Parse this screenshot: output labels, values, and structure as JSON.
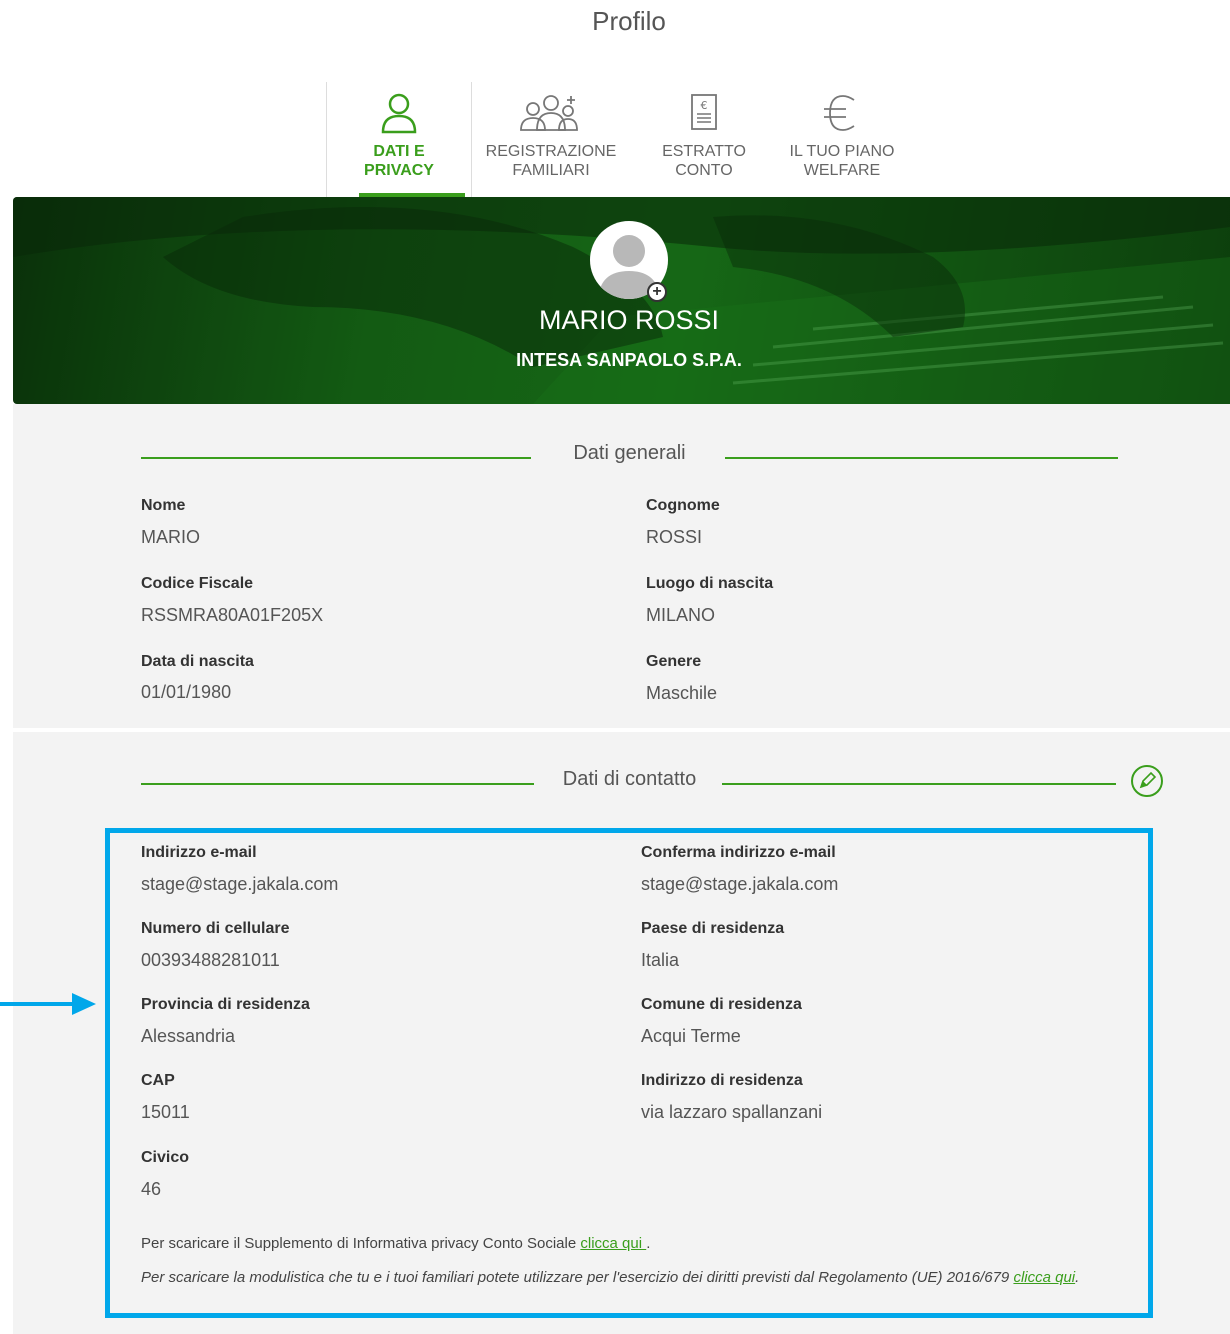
{
  "page": {
    "title": "Profilo"
  },
  "tabs": [
    {
      "label_1": "DATI E",
      "label_2": "PRIVACY",
      "icon": "user-icon",
      "active": true
    },
    {
      "label_1": "REGISTRAZIONE",
      "label_2": "FAMILIARI",
      "icon": "family-icon"
    },
    {
      "label_1": "ESTRATTO",
      "label_2": "CONTO",
      "icon": "statement-icon"
    },
    {
      "label_1": "IL TUO PIANO",
      "label_2": "WELFARE",
      "icon": "euro-icon"
    }
  ],
  "profile": {
    "name": "MARIO ROSSI",
    "company": "INTESA SANPAOLO S.P.A."
  },
  "general": {
    "title": "Dati generali",
    "fields": [
      {
        "label": "Nome",
        "value": "MARIO"
      },
      {
        "label": "Cognome",
        "value": "ROSSI"
      },
      {
        "label": "Codice Fiscale",
        "value": "RSSMRA80A01F205X"
      },
      {
        "label": "Luogo di nascita",
        "value": "MILANO"
      },
      {
        "label": "Data di nascita",
        "value": "01/01/1980"
      },
      {
        "label": "Genere",
        "value": "Maschile"
      }
    ]
  },
  "contact": {
    "title": "Dati di contatto",
    "fields": [
      {
        "label": "Indirizzo e-mail",
        "value": "stage@stage.jakala.com"
      },
      {
        "label": "Conferma indirizzo e-mail",
        "value": "stage@stage.jakala.com"
      },
      {
        "label": "Numero di cellulare",
        "value": "00393488281011"
      },
      {
        "label": "Paese di residenza",
        "value": "Italia"
      },
      {
        "label": "Provincia di residenza",
        "value": "Alessandria"
      },
      {
        "label": "Comune di residenza",
        "value": "Acqui Terme"
      },
      {
        "label": "CAP",
        "value": "15011"
      },
      {
        "label": "Indirizzo di residenza",
        "value": "via lazzaro spallanzani"
      },
      {
        "label": "Civico",
        "value": "46"
      }
    ],
    "note_1": "Per scaricare il Supplemento di Informativa privacy Conto Sociale ",
    "note_1_link": "clicca qui ",
    "note_1_end": ".",
    "note_2": "Per scaricare la modulistica che tu e i tuoi familiari potete utilizzare per l'esercizio dei diritti previsti dal Regolamento (UE) 2016/679 ",
    "note_2_link": "clicca qui",
    "note_2_end": "."
  },
  "colors": {
    "accent": "#3a9e1c",
    "highlight": "#00a7ea"
  }
}
